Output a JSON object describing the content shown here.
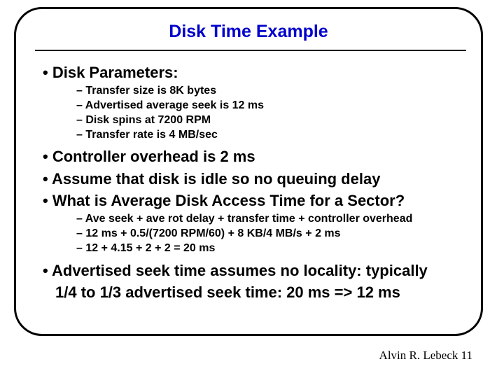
{
  "title": "Disk Time Example",
  "bullets": {
    "b1": "Disk Parameters:",
    "b1_sub": [
      "Transfer size is 8K bytes",
      "Advertised average seek is 12 ms",
      "Disk spins at 7200 RPM",
      "Transfer rate is 4 MB/sec"
    ],
    "b2": "Controller overhead is 2 ms",
    "b3": "Assume that disk is idle so no queuing delay",
    "b4": "What is Average Disk Access Time for a Sector?",
    "b4_sub": [
      "Ave seek + ave rot delay + transfer time + controller overhead",
      "12 ms + 0.5/(7200 RPM/60) + 8 KB/4 MB/s + 2 ms",
      "12 + 4.15 + 2 + 2 = 20 ms"
    ],
    "b5_line1": "Advertised seek time assumes no locality: typically",
    "b5_line2": "1/4 to 1/3 advertised seek time: 20 ms => 12 ms"
  },
  "footer": "Alvin R. Lebeck 11"
}
